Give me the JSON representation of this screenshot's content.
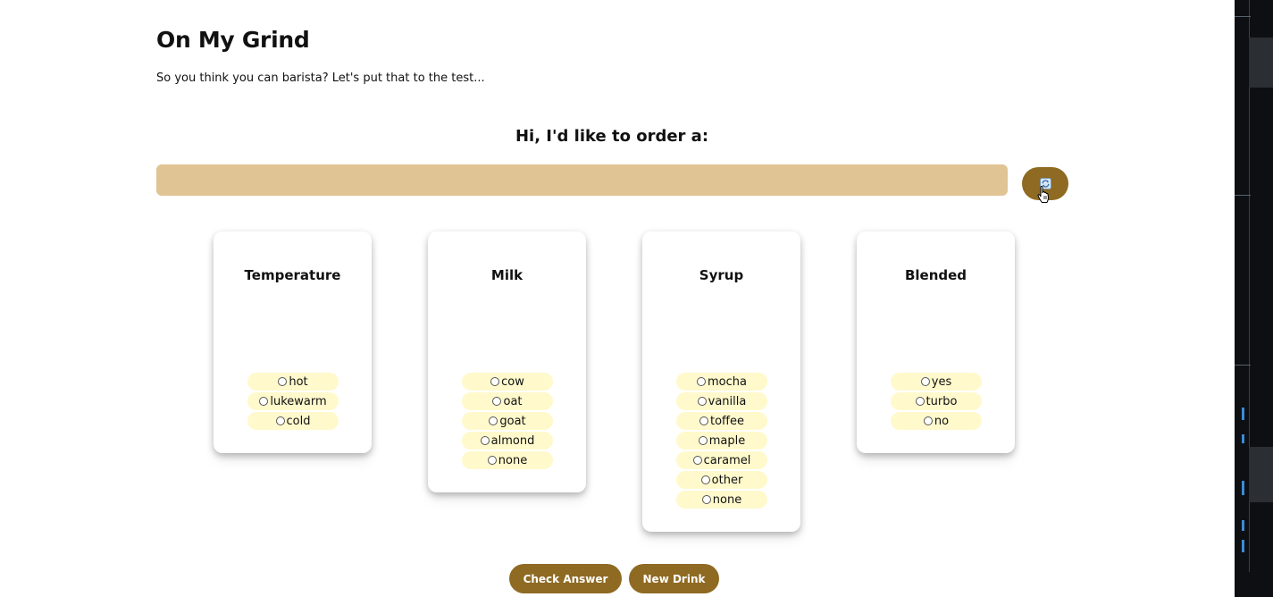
{
  "app": {
    "title": "On My Grind",
    "tagline": "So you think you can barista? Let's put that to the test..."
  },
  "order": {
    "heading": "Hi, I'd like to order a:",
    "display_value": "",
    "refresh_icon": "refresh-icon"
  },
  "cards": [
    {
      "title": "Temperature",
      "options": [
        "hot",
        "lukewarm",
        "cold"
      ]
    },
    {
      "title": "Milk",
      "options": [
        "cow",
        "oat",
        "goat",
        "almond",
        "none"
      ]
    },
    {
      "title": "Syrup",
      "options": [
        "mocha",
        "vanilla",
        "toffee",
        "maple",
        "caramel",
        "other",
        "none"
      ]
    },
    {
      "title": "Blended",
      "options": [
        "yes",
        "turbo",
        "no"
      ]
    }
  ],
  "actions": {
    "check_label": "Check Answer",
    "new_label": "New Drink"
  },
  "colors": {
    "accent": "#8e6a22",
    "order_bar": "#e1c493",
    "option_bg": "#fff9cc"
  }
}
